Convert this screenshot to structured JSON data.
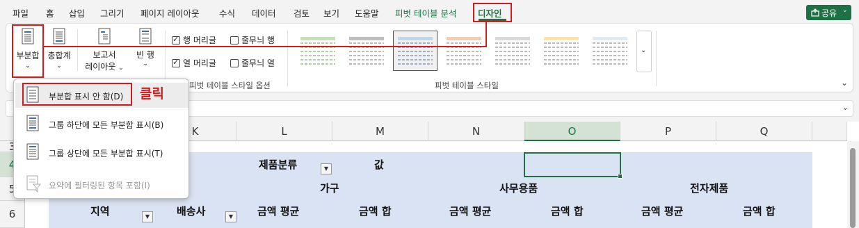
{
  "menu": {
    "items": [
      "파일",
      "홈",
      "삽입",
      "그리기",
      "페이지 레이아웃",
      "수식",
      "데이터",
      "검토",
      "보기",
      "도움말",
      "피벗 테이블 분석",
      "디자인"
    ],
    "share": "공유"
  },
  "ribbon": {
    "subtotals": "부분합",
    "grand_totals": "총합계",
    "report_layout_1": "보고서",
    "report_layout_2": "레이아웃",
    "blank_rows_1": "빈 행",
    "row_headers": "행 머리글",
    "banded_rows": "줄무늬 행",
    "col_headers": "열 머리글",
    "banded_cols": "줄무늬 열",
    "style_options_label": "피벗 테이블 스타일 옵션",
    "styles_label": "피벗 테이블 스타일"
  },
  "dropdown": {
    "items": [
      {
        "label": "부분합 표시 안 함(D)"
      },
      {
        "label": "그룹 하단에 모든 부분합 표시(B)"
      },
      {
        "label": "그룹 상단에 모든 부분합 표시(T)"
      },
      {
        "label": "요약에 필터링된 항목 포함(I)"
      }
    ]
  },
  "annotation": {
    "click": "클릭"
  },
  "grid": {
    "columns": [
      "K",
      "L",
      "M",
      "N",
      "O",
      "P",
      "Q"
    ],
    "rows": [
      "3",
      "4",
      "5",
      "6"
    ],
    "cells": {
      "category_header": "제품분류",
      "values_header": "값",
      "furniture": "가구",
      "office": "사무용품",
      "electronics": "전자제품",
      "region": "지역",
      "shipper": "배송사",
      "avg1": "금액 평균",
      "sum1": "금액 합",
      "avg2": "금액 평균",
      "sum2": "금액 합",
      "avg3": "금액 평균",
      "sum3": "금액 합"
    }
  },
  "colors": {
    "accent": "#1e7145",
    "annotation": "#d01c1c",
    "pivot_fill": "#dae3f3"
  }
}
